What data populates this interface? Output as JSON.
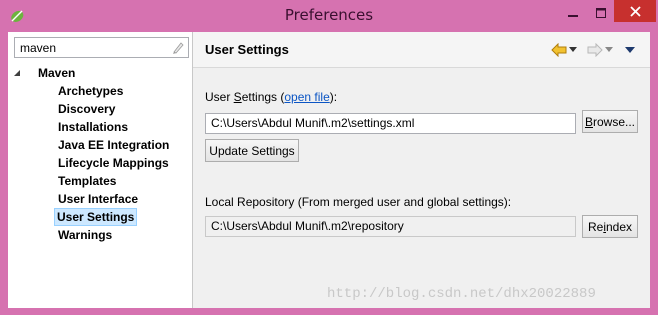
{
  "window": {
    "title": "Preferences",
    "titlebar_color": "#d672b0",
    "close_button_color": "#c7302e"
  },
  "filter": {
    "value": "maven",
    "clear_icon": "clear-filter-icon"
  },
  "tree": {
    "root_label": "Maven",
    "items": [
      {
        "label": "Archetypes"
      },
      {
        "label": "Discovery"
      },
      {
        "label": "Installations"
      },
      {
        "label": "Java EE Integration"
      },
      {
        "label": "Lifecycle Mappings"
      },
      {
        "label": "Templates"
      },
      {
        "label": "User Interface"
      },
      {
        "label": "User Settings",
        "selected": true
      },
      {
        "label": "Warnings"
      }
    ]
  },
  "page": {
    "title": "User Settings",
    "user_settings_label_pre": "User ",
    "user_settings_label_mnemonic": "S",
    "user_settings_label_post": "ettings (",
    "open_file_link": "open file",
    "user_settings_label_end": "):",
    "user_settings_path": "C:\\Users\\Abdul Munif\\.m2\\settings.xml",
    "browse_label_mnemonic": "B",
    "browse_label_rest": "rowse...",
    "update_settings_label": "Update Settings",
    "local_repo_label": "Local Repository (From merged user and global settings):",
    "local_repo_path": "C:\\Users\\Abdul Munif\\.m2\\repository",
    "reindex_label_pre": "Re",
    "reindex_label_mnemonic": "i",
    "reindex_label_post": "ndex"
  },
  "watermark": "http://blog.csdn.net/dhx20022889",
  "colors": {
    "selection_bg": "#cde8ff",
    "link": "#0b55c4",
    "nav_arrow": "#e6a817"
  }
}
